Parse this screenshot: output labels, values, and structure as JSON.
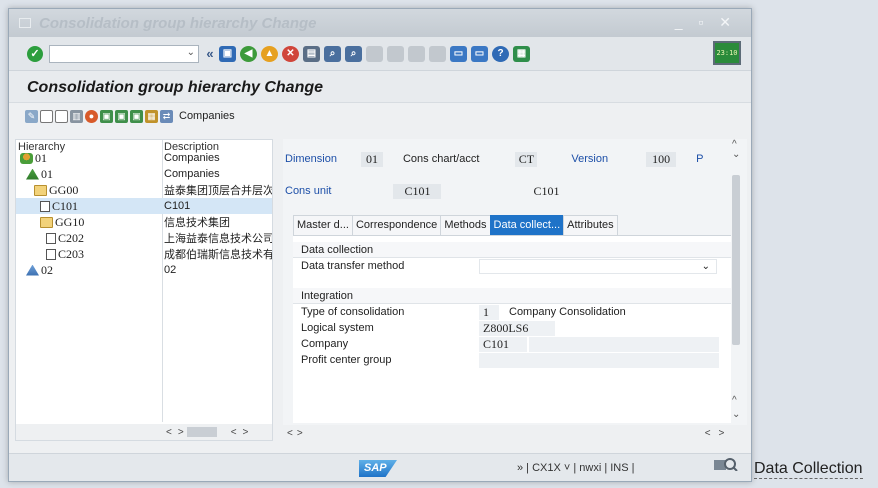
{
  "window": {
    "title": "Consolidation group hierarchy Change",
    "controls": "_ ▫ ✕"
  },
  "toolbar": {
    "clock": "23:10"
  },
  "page": {
    "title": "Consolidation group hierarchy Change"
  },
  "app_toolbar": {
    "companies_label": "Companies"
  },
  "tree": {
    "headers": {
      "hierarchy": "Hierarchy",
      "description": "Description"
    },
    "rows": [
      {
        "node": "01",
        "desc": "Companies"
      },
      {
        "node": "01",
        "desc": "Companies"
      },
      {
        "node": "GG00",
        "desc": "益泰集团顶层合并层次"
      },
      {
        "node": "C101",
        "desc": "C101"
      },
      {
        "node": "GG10",
        "desc": "信息技术集团"
      },
      {
        "node": "C202",
        "desc": "上海益泰信息技术公司"
      },
      {
        "node": "C203",
        "desc": "成都伯瑞斯信息技术有"
      },
      {
        "node": "02",
        "desc": "02"
      }
    ]
  },
  "header": {
    "dimension_label": "Dimension",
    "dimension_value": "01",
    "chart_label": "Cons chart/acct",
    "chart_value": "CT",
    "version_label": "Version",
    "version_value": "100",
    "trunc_label": "P",
    "unit_label": "Cons unit",
    "unit_value": "C101",
    "unit_desc": "C101"
  },
  "tabs": [
    "Master d...",
    "Correspondence",
    "Methods",
    "Data collect...",
    "Attributes"
  ],
  "data_collection": {
    "title": "Data collection",
    "transfer_label": "Data transfer method",
    "transfer_value": ""
  },
  "integration": {
    "title": "Integration",
    "type_label": "Type of consolidation",
    "type_code": "1",
    "type_desc": "Company Consolidation",
    "logical_label": "Logical system",
    "logical_value": "Z800LS6",
    "company_label": "Company",
    "company_value": "C101",
    "pcg_label": "Profit center group",
    "pcg_value": ""
  },
  "status": {
    "sap": "SAP",
    "info": "» | CX1X ˅ | nwxi | INS |",
    "data_collection": "Data Collection"
  }
}
